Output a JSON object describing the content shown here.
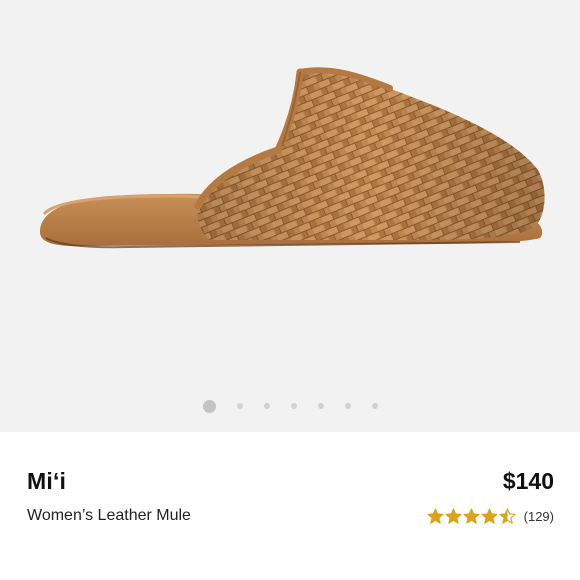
{
  "product": {
    "brand": "Mi‘i",
    "name": "Women’s Leather Mule",
    "price": "$140",
    "rating": {
      "value": 4.5,
      "max": 5,
      "count_label": "(129)",
      "star_color": "#d9a31a"
    }
  },
  "gallery": {
    "image_subject": "woven tan leather mule slipper",
    "image_count": 7,
    "active_index": 0,
    "background_color": "#f2f2f2",
    "leather_color": "#c2884f"
  }
}
